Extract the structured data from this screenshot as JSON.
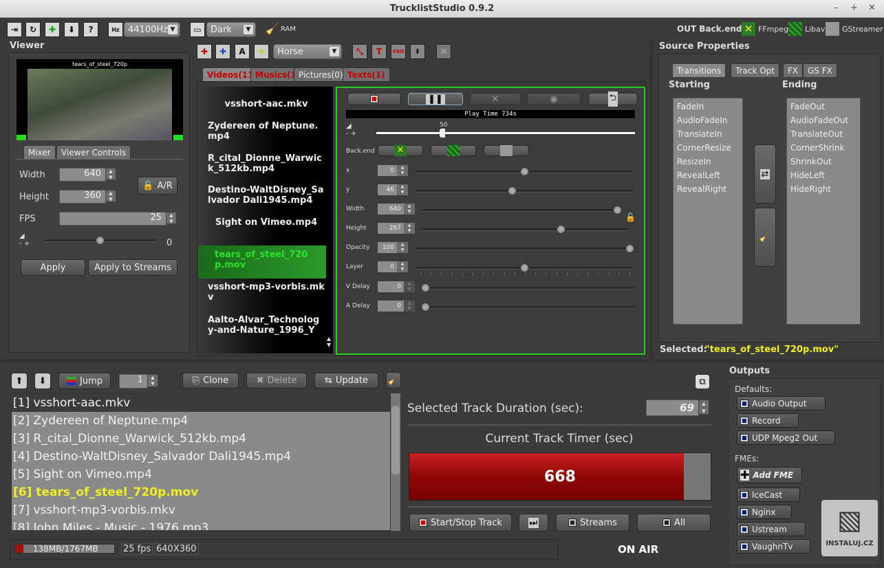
{
  "window": {
    "title": "TrucklistStudio 0.9.2",
    "min": "–",
    "max": "+",
    "close": "✕"
  },
  "toolbar": {
    "sample_rate": "44100Hz",
    "theme": "Dark",
    "ram_label": "RAM",
    "hz_icon": "Hz",
    "backend_label": "OUT Back.end:",
    "backends": [
      "FFmpeg",
      "Libav",
      "GStreamer"
    ]
  },
  "viewer": {
    "title": "Viewer",
    "preview_caption": "tears_of_steel_720p",
    "tabs": [
      "Mixer",
      "Viewer Controls"
    ],
    "width_label": "Width",
    "width": "640",
    "height_label": "Height",
    "height": "360",
    "fps_label": "FPS",
    "fps": "25",
    "ar_label": "A/R",
    "volume": "0",
    "apply": "Apply",
    "apply_streams": "Apply to Streams"
  },
  "sources": {
    "effect_combo": "Horse",
    "osd": "OSD",
    "tabs": [
      "Videos(11)",
      "Musics(1)",
      "Pictures(0)",
      "Texts(1)"
    ],
    "items": [
      "vsshort-aac.mkv",
      "Zydereen of Neptune.mp4",
      "R_cital_Dionne_Warwick_512kb.mp4",
      "Destino-WaltDisney_Salvador Dali1945.mp4",
      "Sight on Vimeo.mp4",
      "tears_of_steel_720p.mov",
      "vsshort-mp3-vorbis.mkv",
      "Aalto-Alvar_Technology-and-Nature_1996_Y"
    ],
    "selected_index": 5
  },
  "controls": {
    "play_time": "Play Time 734s",
    "volume": "50",
    "volume_pct": 50,
    "backend_label": "Back.end",
    "fields": [
      {
        "label": "x",
        "value": "0",
        "pct": 50
      },
      {
        "label": "y",
        "value": "46",
        "pct": 44
      },
      {
        "label": "Width",
        "value": "640",
        "pct": 100
      },
      {
        "label": "Height",
        "value": "267",
        "pct": 68
      },
      {
        "label": "Opacity",
        "value": "100",
        "pct": 100
      },
      {
        "label": "Layer",
        "value": "0",
        "pct": 50
      },
      {
        "label": "V Delay",
        "value": "0",
        "pct": 0
      },
      {
        "label": "A Delay",
        "value": "0",
        "pct": 0
      }
    ]
  },
  "props": {
    "title": "Source Properties",
    "tabs": [
      "Transitions",
      "Track Opt",
      "FX",
      "GS FX"
    ],
    "starting_label": "Starting",
    "ending_label": "Ending",
    "starting": [
      "FadeIn",
      "AudioFadeIn",
      "TranslateIn",
      "CornerResize",
      "ResizeIn",
      "RevealLeft",
      "RevealRight"
    ],
    "ending": [
      "FadeOut",
      "AudioFadeOut",
      "TranslateOut",
      "CornerShrink",
      "ShrinkOut",
      "HideLeft",
      "HideRight"
    ],
    "selected_label": "Selected:",
    "selected_value": "\"tears_of_steel_720p.mov\""
  },
  "playlist": {
    "jump": "Jump",
    "jump_value": "1",
    "clone": "Clone",
    "delete": "Delete",
    "update": "Update",
    "items": [
      "[1] vsshort-aac.mkv",
      "[2] Zydereen of Neptune.mp4",
      "[3] R_cital_Dionne_Warwick_512kb.mp4",
      "[4] Destino-WaltDisney_Salvador Dali1945.mp4",
      "[5] Sight on Vimeo.mp4",
      "[6] tears_of_steel_720p.mov",
      "[7] vsshort-mp3-vorbis.mkv",
      "[8] John Miles - Music - 1976.mp3"
    ],
    "current_index": 5
  },
  "track": {
    "duration_label": "Selected Track Duration (sec):",
    "duration": "69",
    "timer_label": "Current Track Timer (sec)",
    "timer": "668",
    "start_stop": "Start/Stop Track",
    "streams": "Streams",
    "all": "All"
  },
  "status": {
    "memory": "138MB/1767MB",
    "memory_pct": 8,
    "fps": "25 fps",
    "resolution": "640X360",
    "on_air": "ON AIR"
  },
  "outputs": {
    "title": "Outputs",
    "defaults_label": "Defaults:",
    "defaults": [
      "Audio Output",
      "Record",
      "UDP Mpeg2 Out"
    ],
    "fmes_label": "FMEs:",
    "add_fme": "Add FME",
    "fmes": [
      "IceCast",
      "Nginx",
      "Ustream",
      "VaughnTv"
    ],
    "watermark": "INSTALUJ.CZ"
  },
  "colors": {
    "accent_green": "#22cc22",
    "selected_yellow": "#f0f020",
    "timer_red": "#b01010"
  }
}
